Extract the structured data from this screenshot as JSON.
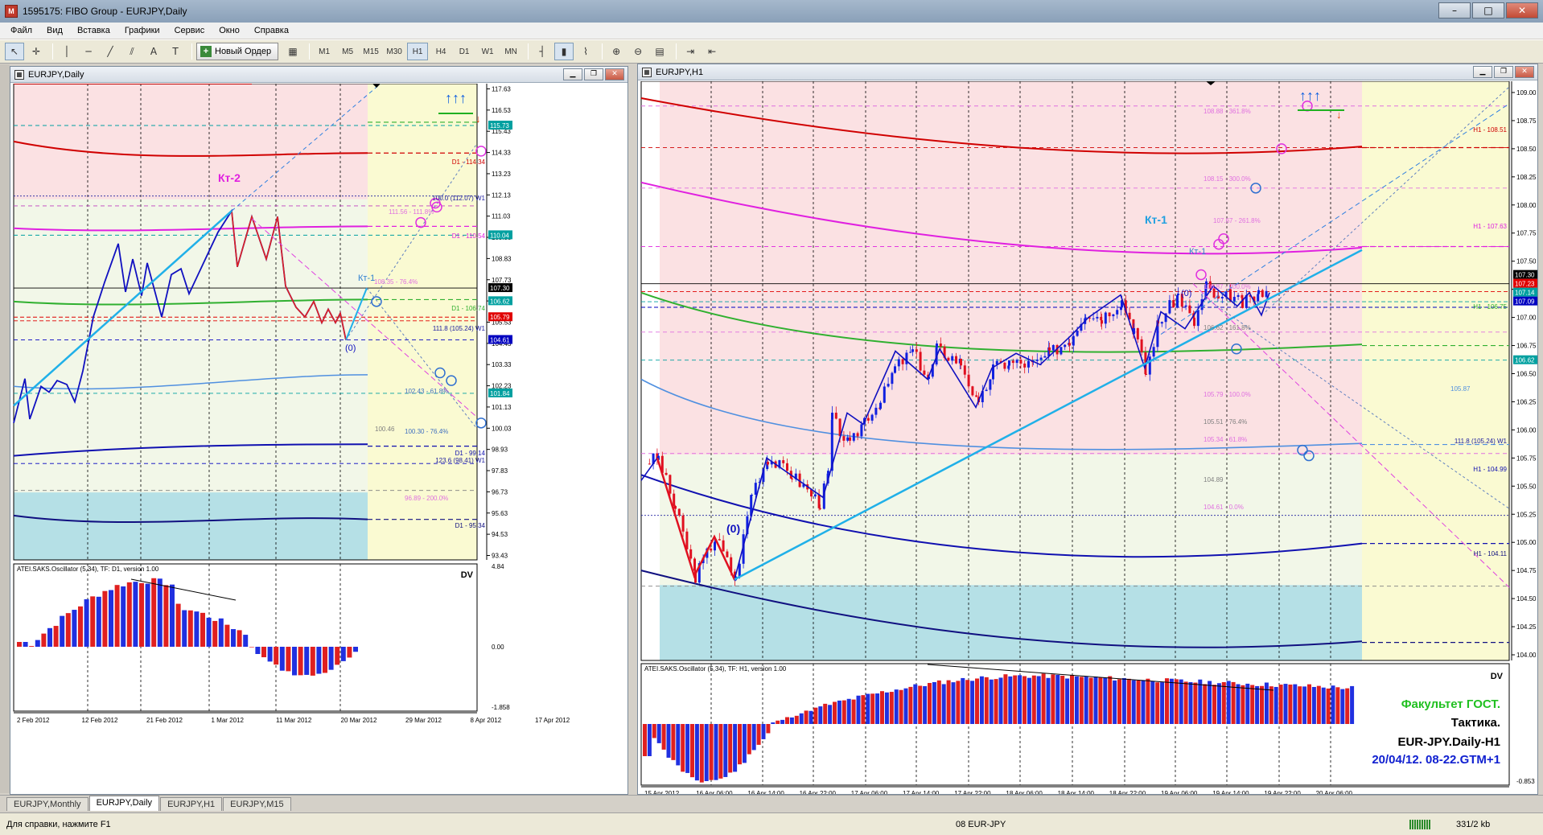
{
  "window": {
    "title": "1595175: FIBO Group - EURJPY,Daily",
    "controls": {
      "minimize": "–",
      "maximize": "□",
      "close": "✕"
    }
  },
  "menu": [
    "Файл",
    "Вид",
    "Вставка",
    "Графики",
    "Сервис",
    "Окно",
    "Справка"
  ],
  "toolbar": {
    "new_order": "Новый Ордер",
    "timeframes": [
      "M1",
      "M5",
      "M15",
      "M30",
      "H1",
      "H4",
      "D1",
      "W1",
      "MN"
    ],
    "active_timeframe": "H1"
  },
  "left_chart": {
    "title": "EURJPY,Daily",
    "price_ticks": [
      "117.63",
      "116.53",
      "115.43",
      "114.33",
      "113.23",
      "112.13",
      "111.03",
      "109.93",
      "108.83",
      "107.73",
      "106.63",
      "105.53",
      "104.43",
      "103.33",
      "102.23",
      "101.13",
      "100.03",
      "98.93",
      "97.83",
      "96.73",
      "95.63",
      "94.53",
      "93.43"
    ],
    "date_ticks": [
      "2 Feb 2012",
      "12 Feb 2012",
      "21 Feb 2012",
      "1 Mar 2012",
      "11 Mar 2012",
      "20 Mar 2012",
      "29 Mar 2012",
      "8 Apr 2012",
      "17 Apr 2012"
    ],
    "price_boxes": [
      {
        "v": "115.73",
        "c": "#00a0a0"
      },
      {
        "v": "110.04",
        "c": "#00a0a0"
      },
      {
        "v": "107.30",
        "c": "#000000"
      },
      {
        "v": "106.62",
        "c": "#00a0a0"
      },
      {
        "v": "105.79",
        "c": "#e00000"
      },
      {
        "v": "104.61",
        "c": "#0000c0"
      },
      {
        "v": "101.84",
        "c": "#00a0a0"
      }
    ],
    "labels": {
      "kt2": "Кт-2",
      "kt1": "Кт-1",
      "zero": "(0)",
      "d1_114": "D1 - 114.34",
      "fibo_100": "100.0 (112.07) W1",
      "d1_110": "D1 - 110.54",
      "d1_106": "D1 - 106.74",
      "fibo_1118": "111.8 (105.24) W1",
      "fibo_618": "102.43 - 61.8%",
      "fibo_100_46": "100.46",
      "fibo_764": "100.30 - 76.4%",
      "d1_99": "D1 - 99.14",
      "fibo_1236": "123.6 (98.41) W1",
      "fibo_200": "96.89 - 200.0%",
      "d1_95": "D1 - 95.34",
      "fibo_108": "108.35 - 76.4%",
      "fibo_1116": "111.56 - 111.8%"
    },
    "osc": {
      "title": "ATEI.SAKS.Oscillator (5,34), TF: D1, version 1.00",
      "dv": "DV",
      "ticks": [
        "4.84",
        "0.00",
        "-1.858"
      ]
    }
  },
  "right_chart": {
    "title": "EURJPY,H1",
    "price_ticks": [
      "109.00",
      "108.75",
      "108.50",
      "108.25",
      "108.00",
      "107.75",
      "107.50",
      "107.25",
      "107.00",
      "106.75",
      "106.50",
      "106.25",
      "106.00",
      "105.75",
      "105.50",
      "105.25",
      "105.00",
      "104.75",
      "104.50",
      "104.25",
      "104.00"
    ],
    "date_ticks": [
      "15 Apr 2012",
      "16 Apr 06:00",
      "16 Apr 14:00",
      "16 Apr 22:00",
      "17 Apr 06:00",
      "17 Apr 14:00",
      "17 Apr 22:00",
      "18 Apr 06:00",
      "18 Apr 14:00",
      "18 Apr 22:00",
      "19 Apr 06:00",
      "19 Apr 14:00",
      "19 Apr 22:00",
      "20 Apr 06:00"
    ],
    "price_boxes": [
      {
        "v": "107.30",
        "c": "#000000"
      },
      {
        "v": "107.23",
        "c": "#e00000"
      },
      {
        "v": "107.14",
        "c": "#00a0a0"
      },
      {
        "v": "107.09",
        "c": "#0000c0"
      },
      {
        "v": "106.62",
        "c": "#00a0a0"
      }
    ],
    "labels": {
      "kt1": "Кт-1",
      "kt1b": "Кт-1",
      "zero": "(0)",
      "zero_small": "(0)",
      "h1_108": "H1 - 108.51",
      "fibo_3618": "108.88 - 361.8%",
      "fibo_300": "108.15 - 300.0%",
      "fibo_2618": "107.67 - 261.8%",
      "h1_107": "H1 - 107.63",
      "fibo_200": "106.87 - 200.0%",
      "h1_106": "H1 - 106.75",
      "fibo_1618": "106.62 - 161.8%",
      "val_105_87": "105.87",
      "fibo_100": "105.79 - 100.0%",
      "fibo_764": "105.51 - 76.4%",
      "fibo_618": "105.34 - 61.8%",
      "fibo_w1": "111.8 (105.24) W1",
      "h1_104_99": "H1 - 104.99",
      "val_104_89": "104.89",
      "fibo_0": "104.61 - 0.0%",
      "h1_104_11": "H1 - 104.11"
    },
    "osc": {
      "title": "ATEI.SAKS.Oscillator (5,34), TF: H1,  version 1.00",
      "dv": "DV",
      "ticks": [
        "-0.853"
      ]
    },
    "caption": {
      "l1": "Факультет ГОСТ.",
      "l2": "Тактика.",
      "l3": "EUR-JPY.Daily-H1",
      "l4": "20/04/12. 08-22.GTM+1"
    }
  },
  "tabs": [
    "EURJPY,Monthly",
    "EURJPY,Daily",
    "EURJPY,H1",
    "EURJPY,M15"
  ],
  "active_tab": "EURJPY,Daily",
  "status": {
    "help": "Для справки, нажмите F1",
    "profile": "08 EUR-JPY",
    "traffic": "331/2 kb"
  }
}
